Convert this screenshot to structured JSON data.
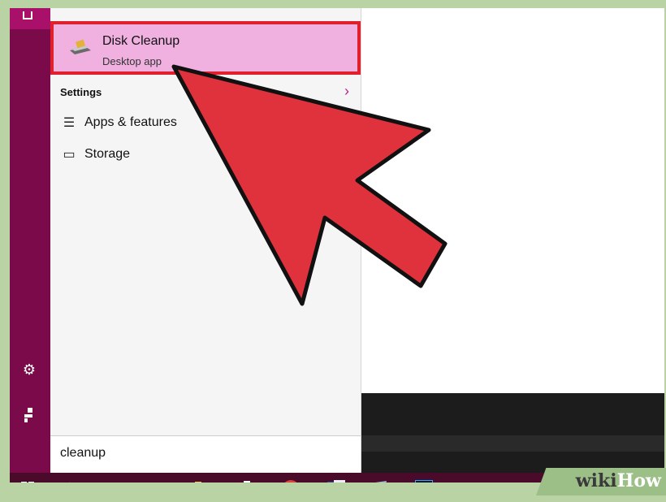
{
  "start_menu": {
    "top_result": {
      "title": "Disk Cleanup",
      "subtitle": "Desktop app"
    },
    "settings_header": "Settings",
    "settings_items": [
      {
        "label": "Apps & features",
        "icon": "apps-features-icon"
      },
      {
        "label": "Storage",
        "icon": "storage-icon"
      }
    ],
    "search_query": "cleanup"
  },
  "taskbar": {
    "items": [
      "start-icon",
      "search-icon",
      "task-view-icon",
      "edge-icon",
      "file-explorer-icon",
      "store-icon",
      "chrome-icon",
      "word-icon",
      "app-icon",
      "photoshop-icon"
    ]
  },
  "watermark": {
    "part1": "wiki",
    "part2": "How"
  },
  "colors": {
    "accent": "#7a0a4a",
    "highlight": "#f0b0e0",
    "arrow": "#e0323c"
  }
}
